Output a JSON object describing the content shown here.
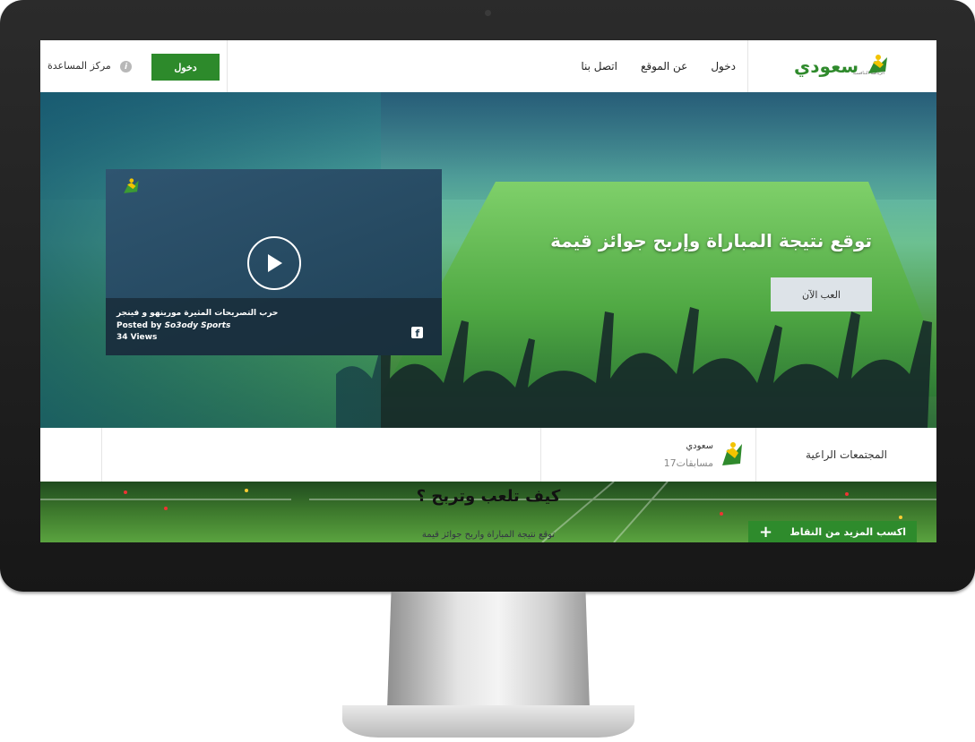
{
  "header": {
    "logo_text": "سعودي",
    "logo_tagline": "الرياضة التنافسية",
    "nav": [
      "دخول",
      "عن الموقع",
      "اتصل بنا"
    ],
    "login_button": "دخول",
    "help_center": "مركز المساعدة",
    "help_icon_glyph": "i"
  },
  "hero": {
    "title": "توقع نتيجة المباراة وإربح جوائز قيمة",
    "play_button": "العب الآن",
    "video": {
      "title": "حرب التصريحات المثيرة مورينهو و فينجر",
      "posted_prefix": "Posted by",
      "posted_by": "So3ody Sports",
      "views": "34 Views"
    }
  },
  "sponsors": {
    "label": "المجتمعات الراعية",
    "items": [
      {
        "name": "سعودي",
        "count": "17مسابقات"
      }
    ]
  },
  "how": {
    "title": "كيف تلعب وتربح ؟",
    "text": "توقع نتيجة المباراة واربح جوائز قيمة",
    "more_points": "اكسب المزيد من النقاط",
    "more_points_icon": "+"
  },
  "colors": {
    "brand_green": "#2d8a2b",
    "bezel": "#1e1e1e"
  }
}
